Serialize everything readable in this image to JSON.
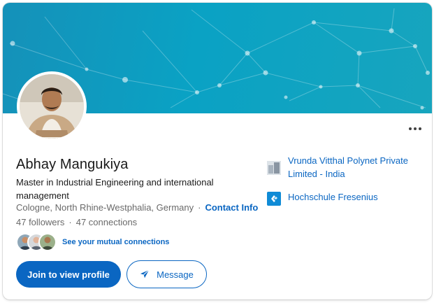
{
  "profile": {
    "name": "Abhay Mangukiya",
    "headline": "Master in Industrial Engineering and international management",
    "location": "Cologne, North Rhine-Westphalia, Germany",
    "location_separator": "·",
    "contact_info_label": "Contact Info",
    "followers_label": "47 followers",
    "stats_separator": "·",
    "connections_label": "47 connections"
  },
  "mutual": {
    "link_label": "See your mutual connections"
  },
  "actions": {
    "join_label": "Join to view profile",
    "message_label": "Message"
  },
  "organizations": [
    {
      "name": "Vrunda Vitthal Polynet Private Limited - India",
      "logo": "company-logo-placeholder"
    },
    {
      "name": "Hochschule Fresenius",
      "logo": "hochschule-fresenius-logo"
    }
  ],
  "icons": {
    "more": "more-horizontal-icon",
    "message": "send-arrow-icon"
  },
  "colors": {
    "brand_blue": "#0a66c2",
    "banner_start": "#1591b9",
    "banner_end": "#17a5be",
    "muted_text": "#666666"
  }
}
